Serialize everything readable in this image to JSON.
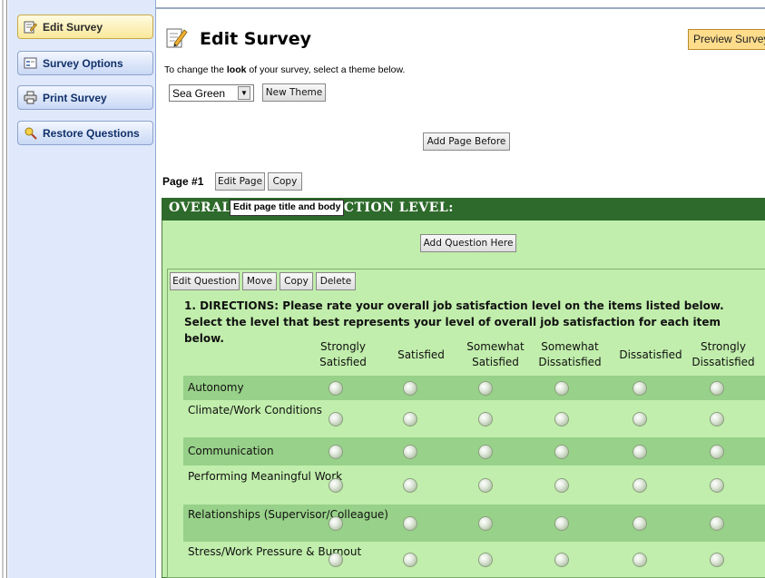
{
  "sidebar": {
    "items": [
      {
        "label": "Edit Survey",
        "icon": "edit-icon"
      },
      {
        "label": "Survey Options",
        "icon": "options-icon"
      },
      {
        "label": "Print Survey",
        "icon": "printer-icon"
      },
      {
        "label": "Restore Questions",
        "icon": "restore-icon"
      }
    ]
  },
  "header": {
    "title": "Edit Survey",
    "preview_label": "Preview Survey",
    "instruction_prefix": "To change the ",
    "instruction_bold": "look",
    "instruction_suffix": " of your survey, select a theme below.",
    "theme_value": "Sea Green",
    "new_theme_label": "New Theme"
  },
  "toolbar": {
    "add_page_before": "Add Page Before",
    "page_label": "Page #1",
    "edit_page": "Edit Page",
    "copy": "Copy"
  },
  "page": {
    "title": "OVERALL JOB SATISFACTION LEVEL:",
    "tooltip": "Edit page title and body",
    "add_question_here": "Add Question Here"
  },
  "question_toolbar": {
    "edit_question": "Edit Question",
    "move": "Move",
    "copy": "Copy",
    "delete": "Delete"
  },
  "question": {
    "text": "1. DIRECTIONS: Please rate your overall job satisfaction level on the items listed below. Select the level that best represents your level of overall job satisfaction for each item below.",
    "columns": [
      "Strongly Satisfied",
      "Satisfied",
      "Somewhat Satisfied",
      "Somewhat Dissatisfied",
      "Dissatisfied",
      "Strongly Dissatisfied"
    ],
    "rows": [
      "Autonomy",
      "Climate/Work Conditions",
      "Communication",
      "Performing Meaningful Work",
      "Relationships (Supervisor/Colleague)",
      "Stress/Work Pressure & Burnout"
    ]
  },
  "colors": {
    "header_green": "#2e6a2b",
    "area_green": "#c1eeac",
    "row_stripe": "#98d189",
    "sidebar_bg": "#dfe9fb",
    "preview_btn": "#fddc8c"
  }
}
